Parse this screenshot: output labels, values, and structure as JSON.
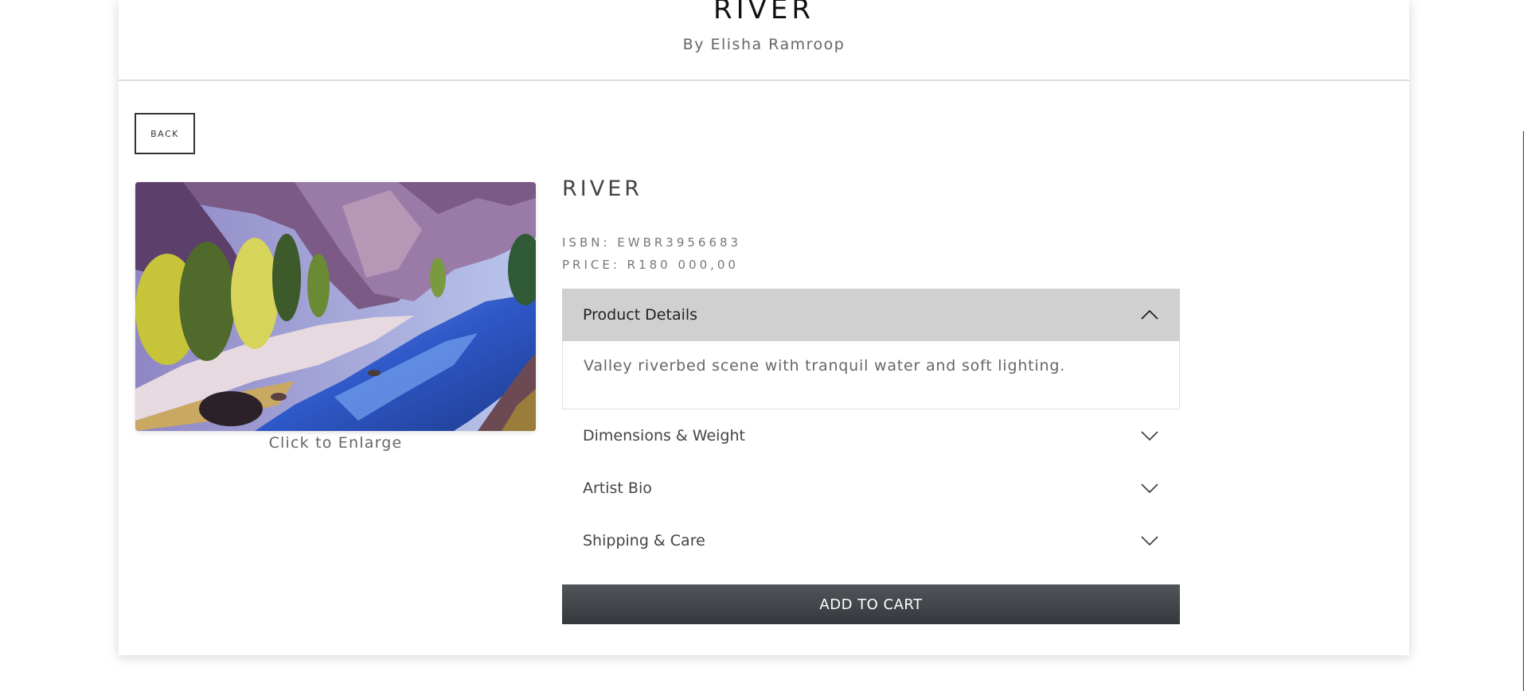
{
  "header": {
    "title": "RIVER",
    "subtitle": "By Elisha Ramroop"
  },
  "back_label": "BACK",
  "artwork": {
    "caption": "Click to Enlarge"
  },
  "product": {
    "title": "RIVER",
    "isbn": "ISBN: EWBR3956683",
    "price": "PRICE: R180 000,00"
  },
  "accordion": {
    "sections": [
      {
        "label": "Product Details",
        "open": true,
        "icon": "chevron-up-icon",
        "body": "Valley riverbed scene with tranquil water and soft lighting."
      },
      {
        "label": "Dimensions & Weight",
        "open": false,
        "icon": "chevron-down-icon"
      },
      {
        "label": "Artist Bio",
        "open": false,
        "icon": "chevron-down-icon"
      },
      {
        "label": "Shipping & Care",
        "open": false,
        "icon": "chevron-down-icon"
      }
    ]
  },
  "cart": {
    "label": "ADD TO CART"
  },
  "colors": {
    "open_header_bg": "#d0d0d0",
    "cart_button_bg": "#3f4347"
  }
}
